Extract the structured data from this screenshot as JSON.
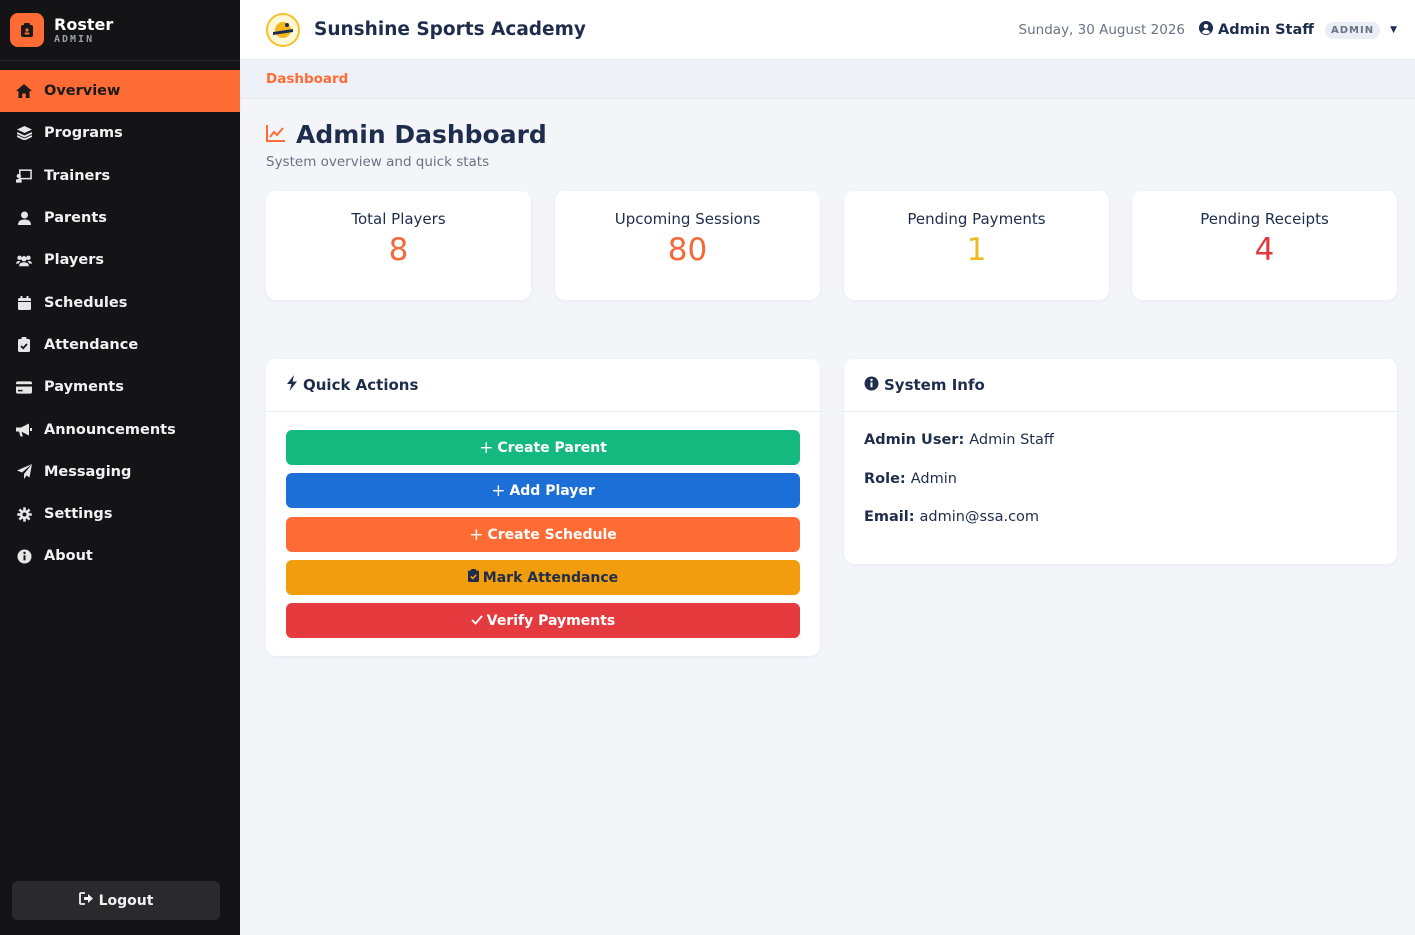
{
  "brand": {
    "name": "Roster",
    "subtitle": "ADMIN"
  },
  "sidebar": {
    "items": [
      {
        "label": "Overview",
        "icon": "home-icon",
        "active": true
      },
      {
        "label": "Programs",
        "icon": "layers-icon"
      },
      {
        "label": "Trainers",
        "icon": "chalkboard-teacher-icon"
      },
      {
        "label": "Parents",
        "icon": "user-icon"
      },
      {
        "label": "Players",
        "icon": "users-icon"
      },
      {
        "label": "Schedules",
        "icon": "calendar-icon"
      },
      {
        "label": "Attendance",
        "icon": "clipboard-check-icon"
      },
      {
        "label": "Payments",
        "icon": "credit-card-icon"
      },
      {
        "label": "Announcements",
        "icon": "megaphone-icon"
      },
      {
        "label": "Messaging",
        "icon": "paper-plane-icon"
      },
      {
        "label": "Settings",
        "icon": "gear-icon"
      },
      {
        "label": "About",
        "icon": "info-circle-icon"
      }
    ],
    "logout_label": "Logout"
  },
  "header": {
    "org_name": "Sunshine Sports Academy",
    "date": "Sunday, 30 August 2026",
    "user_name": "Admin Staff",
    "role_badge": "ADMIN"
  },
  "breadcrumb": "Dashboard",
  "page": {
    "title": "Admin Dashboard",
    "subtitle": "System overview and quick stats"
  },
  "stats": [
    {
      "label": "Total Players",
      "value": "8",
      "color": "#f26a3a"
    },
    {
      "label": "Upcoming Sessions",
      "value": "80",
      "color": "#f26a3a"
    },
    {
      "label": "Pending Payments",
      "value": "1",
      "color": "#f2b824"
    },
    {
      "label": "Pending Receipts",
      "value": "4",
      "color": "#e03a3f"
    }
  ],
  "quick_actions": {
    "title": "Quick Actions",
    "buttons": [
      {
        "label": "Create Parent",
        "color": "#13b97e",
        "icon": "plus-icon"
      },
      {
        "label": "Add Player",
        "color": "#1b6fd6",
        "icon": "plus-icon"
      },
      {
        "label": "Create Schedule",
        "color": "#ff6b35",
        "icon": "plus-icon"
      },
      {
        "label": "Mark Attendance",
        "color": "#f29d0d",
        "icon": "clipboard-check-icon"
      },
      {
        "label": "Verify Payments",
        "color": "#e53b3f",
        "icon": "check-icon"
      }
    ]
  },
  "system_info": {
    "title": "System Info",
    "rows": [
      {
        "key": "Admin User:",
        "value": "Admin Staff"
      },
      {
        "key": "Role:",
        "value": "Admin"
      },
      {
        "key": "Email:",
        "value": "admin@ssa.com"
      }
    ]
  },
  "colors": {
    "accent": "#ff6b35",
    "sidebar_bg": "#141416",
    "heading": "#1f2d4d"
  }
}
